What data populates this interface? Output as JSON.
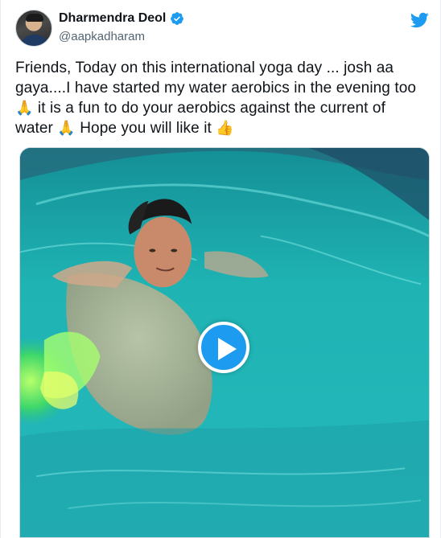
{
  "tweet": {
    "display_name": "Dharmendra Deol",
    "handle": "@aapkadharam",
    "verified": true,
    "text_line1": "Friends, Today on this international yoga day ... josh aa",
    "text_line2": "gaya....I have started my water aerobics in the evening too",
    "emoji_pray": "🙏",
    "text_line3": " it is a fun to do your aerobics against the current of",
    "text_line4a": "water ",
    "text_line4b": " Hope you will like it ",
    "emoji_thumbs": "👍"
  },
  "icons": {
    "brand": "twitter-bird-icon",
    "verified": "verified-badge-icon",
    "media_control": "play-icon"
  },
  "colors": {
    "accent": "#1d9bf0",
    "text": "#0f1419",
    "muted": "#536471"
  }
}
